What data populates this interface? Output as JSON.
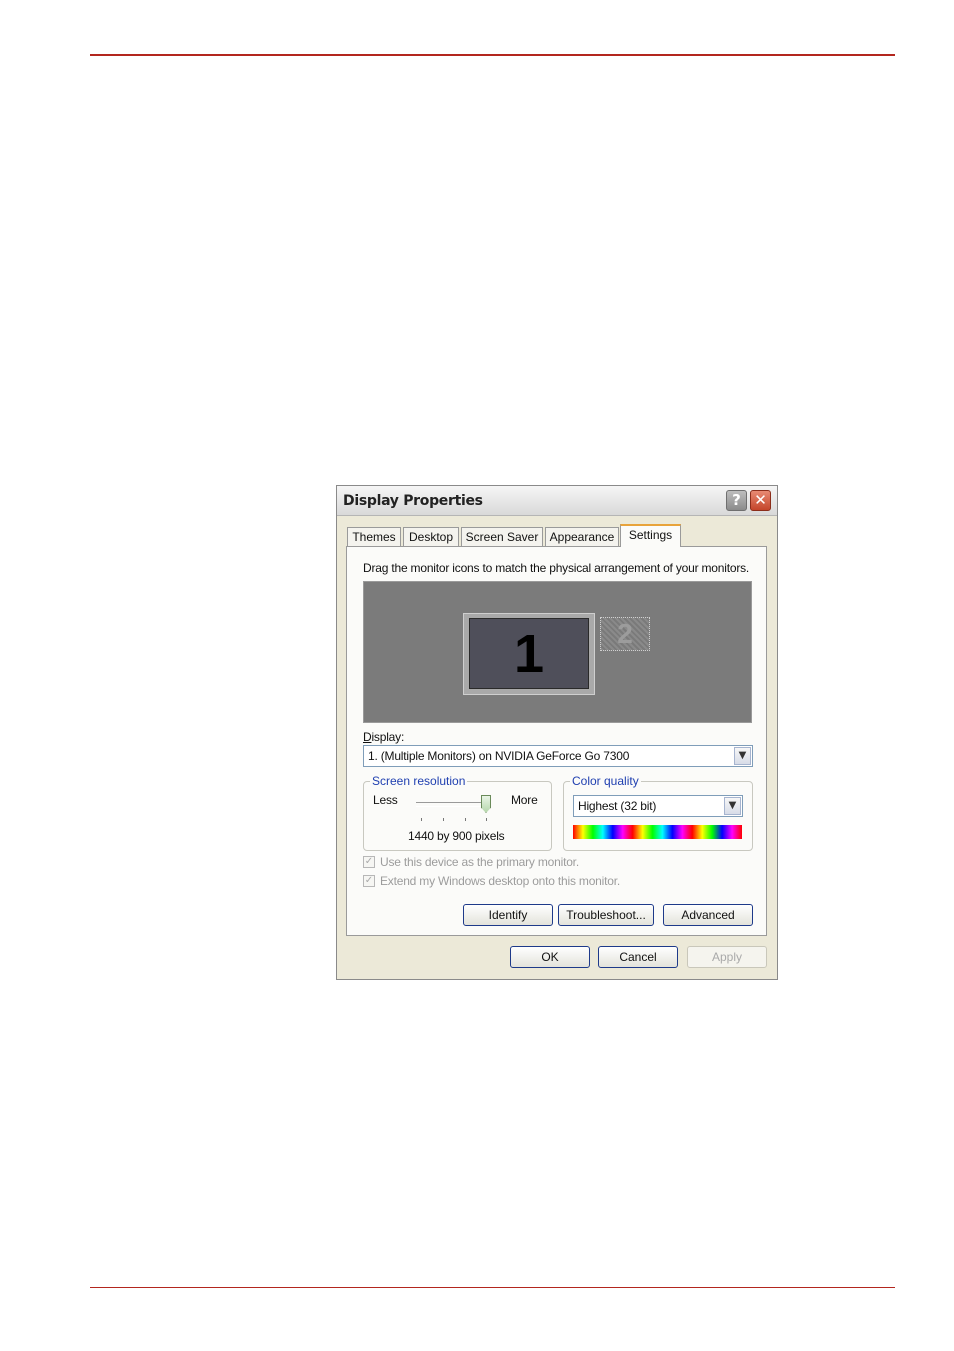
{
  "dialog": {
    "title": "Display Properties",
    "help_glyph": "?",
    "close_glyph": "✕",
    "tabs": [
      {
        "label": "Themes"
      },
      {
        "label": "Desktop"
      },
      {
        "label": "Screen Saver"
      },
      {
        "label": "Appearance"
      },
      {
        "label": "Settings",
        "active": true
      }
    ],
    "instruction": "Drag the monitor icons to match the physical arrangement of your monitors.",
    "monitors": [
      {
        "label": "1"
      },
      {
        "label": "2"
      }
    ],
    "display_label": "Display:",
    "display_value": "1. (Multiple Monitors) on NVIDIA GeForce Go 7300",
    "resolution": {
      "legend": "Screen resolution",
      "less": "Less",
      "more": "More",
      "value": "1440 by 900 pixels",
      "slider_position_fraction": 1.0
    },
    "color_quality": {
      "legend": "Color quality",
      "value": "Highest (32 bit)"
    },
    "checkboxes": {
      "primary": "Use this device as the primary monitor.",
      "extend": "Extend my Windows desktop onto this monitor."
    },
    "buttons": {
      "identify": "Identify",
      "troubleshoot": "Troubleshoot...",
      "advanced": "Advanced",
      "ok": "OK",
      "cancel": "Cancel",
      "apply": "Apply"
    },
    "colors": {
      "page_rule": "#b3261e",
      "dialog_face": "#ece9d8",
      "tab_accent": "#e8a33a",
      "button_border": "#1e3a8a"
    },
    "icons": {
      "help": "question-mark-icon",
      "close": "close-icon",
      "dropdown": "chevron-down-icon",
      "check": "checkmark-icon"
    }
  }
}
